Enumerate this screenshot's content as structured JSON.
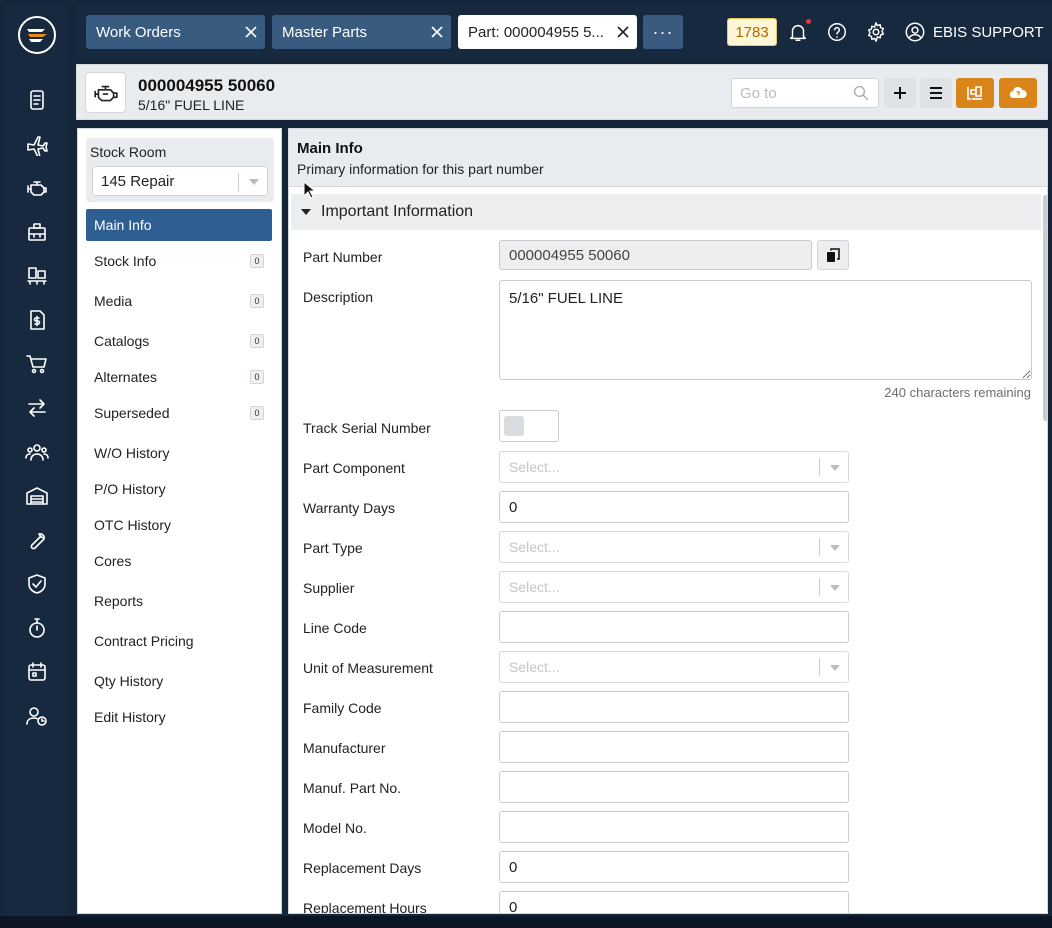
{
  "topbar": {
    "tabs": [
      {
        "label": "Work Orders",
        "active": false
      },
      {
        "label": "Master Parts",
        "active": false
      },
      {
        "label": "Part: 000004955 5...",
        "active": true
      }
    ],
    "more_label": "···",
    "counter": "1783",
    "user_name": "EBIS SUPPORT"
  },
  "rail": {
    "icons": [
      "document-icon",
      "airplane-icon",
      "engine-icon",
      "parts-box-icon",
      "inventory-icon",
      "invoice-dollar-icon",
      "cart-icon",
      "transfer-icon",
      "users-icon",
      "garage-icon",
      "wrench-icon",
      "shield-check-icon",
      "stopwatch-icon",
      "calendar-icon",
      "user-clock-icon"
    ]
  },
  "header": {
    "part_number": "000004955 50060",
    "part_description": "5/16\" FUEL LINE",
    "goto_placeholder": "Go to"
  },
  "side": {
    "stock_room_label": "Stock Room",
    "stock_room_value": "145 Repair",
    "nav": [
      {
        "label": "Main Info",
        "count": null,
        "active": true
      },
      {
        "label": "Stock Info",
        "count": "0"
      },
      {
        "label": "Media",
        "count": "0"
      },
      {
        "label": "Catalogs",
        "count": "0"
      },
      {
        "label": "Alternates",
        "count": "0"
      },
      {
        "label": "Superseded",
        "count": "0"
      },
      {
        "label": "W/O History",
        "count": null
      },
      {
        "label": "P/O History",
        "count": null
      },
      {
        "label": "OTC History",
        "count": null
      },
      {
        "label": "Cores",
        "count": null
      },
      {
        "label": "Reports",
        "count": null
      },
      {
        "label": "Contract Pricing",
        "count": null
      },
      {
        "label": "Qty History",
        "count": null
      },
      {
        "label": "Edit History",
        "count": null
      }
    ]
  },
  "main": {
    "title": "Main Info",
    "subtitle": "Primary information for this part number",
    "section_title": "Important Information",
    "fields": {
      "part_number": {
        "label": "Part Number",
        "value": "000004955 50060"
      },
      "description": {
        "label": "Description",
        "value": "5/16\" FUEL LINE",
        "chars_remaining": "240 characters remaining"
      },
      "track_serial": {
        "label": "Track Serial Number"
      },
      "part_component": {
        "label": "Part Component",
        "placeholder": "Select..."
      },
      "warranty_days": {
        "label": "Warranty Days",
        "value": "0"
      },
      "part_type": {
        "label": "Part Type",
        "placeholder": "Select..."
      },
      "supplier": {
        "label": "Supplier",
        "placeholder": "Select..."
      },
      "line_code": {
        "label": "Line Code",
        "value": ""
      },
      "unit_of_measurement": {
        "label": "Unit of Measurement",
        "placeholder": "Select..."
      },
      "family_code": {
        "label": "Family Code",
        "value": ""
      },
      "manufacturer": {
        "label": "Manufacturer",
        "value": ""
      },
      "manuf_part_no": {
        "label": "Manuf. Part No.",
        "value": ""
      },
      "model_no": {
        "label": "Model No.",
        "value": ""
      },
      "replacement_days": {
        "label": "Replacement Days",
        "value": "0"
      },
      "replacement_hours": {
        "label": "Replacement Hours",
        "value": "0"
      }
    }
  },
  "colors": {
    "rail_bg": "#17293e",
    "tab_inactive": "#3a5b80",
    "nav_active": "#2f5e92",
    "accent_orange": "#d98519",
    "counter_text": "#b06a00"
  }
}
